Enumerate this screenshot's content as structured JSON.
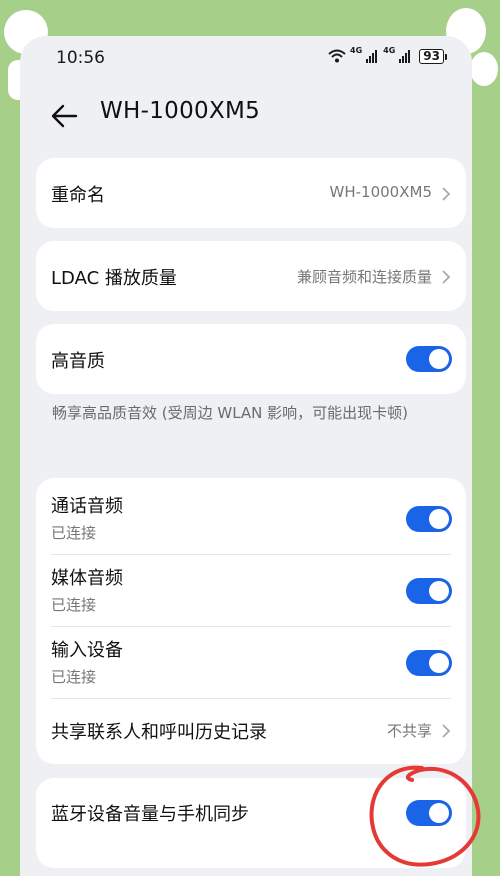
{
  "status_bar": {
    "time": "10:56",
    "network_label_1": "4G",
    "network_label_2": "4G",
    "battery": "93"
  },
  "header": {
    "title": "WH-1000XM5"
  },
  "settings": {
    "rename": {
      "label": "重命名",
      "value": "WH-1000XM5"
    },
    "ldac": {
      "label": "LDAC 播放质量",
      "value": "兼顾音频和连接质量"
    },
    "hq_audio": {
      "label": "高音质",
      "enabled": true
    },
    "hq_hint": "畅享高品质音效 (受周边 WLAN 影响，可能出现卡顿)",
    "call_audio": {
      "label": "通话音频",
      "status": "已连接",
      "enabled": true
    },
    "media_audio": {
      "label": "媒体音频",
      "status": "已连接",
      "enabled": true
    },
    "input_device": {
      "label": "输入设备",
      "status": "已连接",
      "enabled": true
    },
    "share_contacts": {
      "label": "共享联系人和呼叫历史记录",
      "value": "不共享"
    },
    "volume_sync": {
      "label": "蓝牙设备音量与手机同步",
      "enabled": true
    }
  },
  "colors": {
    "toggle_on": "#1a64e8",
    "background": "#a6cf8a",
    "annotation": "#e53935"
  }
}
